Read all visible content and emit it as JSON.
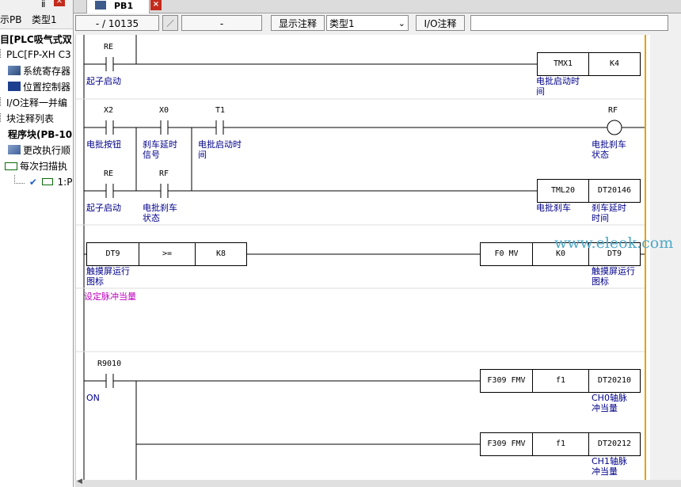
{
  "sidebar": {
    "tab1": "示PB",
    "tab2": "类型1",
    "pin_icon": "pin-icon",
    "items": [
      {
        "label": "目[PLC吸气式双",
        "bold": true
      },
      {
        "label": "PLC[FP-XH C3",
        "bold": false
      },
      {
        "label": "系统寄存器",
        "bold": false
      },
      {
        "label": "位置控制器",
        "bold": false
      },
      {
        "label": "I/O注释一并编",
        "bold": false
      },
      {
        "label": "块注释列表",
        "bold": false
      },
      {
        "label": "程序块(PB-10",
        "bold": true
      },
      {
        "label": "更改执行顺",
        "bold": false
      },
      {
        "label": "每次扫描执",
        "bold": false
      },
      {
        "label": "1:P",
        "bold": false
      }
    ]
  },
  "tab": {
    "label": "PB1"
  },
  "toolbar": {
    "address": "- / 10135",
    "blank": "-",
    "show_comment": "显示注释",
    "type_select": "类型1",
    "io_comment": "I/O注释"
  },
  "ladder": {
    "annotation": "设定脉冲当量",
    "watermark": "www.eleok.com",
    "contacts": [
      {
        "dev": "RE",
        "cmt": "起子启动"
      },
      {
        "dev": "X2",
        "cmt": "电批按钮"
      },
      {
        "dev": "X0",
        "cmt": "刹车延时\n信号"
      },
      {
        "dev": "T1",
        "cmt": "电批启动时\n间"
      },
      {
        "dev": "RE",
        "cmt": "起子启动"
      },
      {
        "dev": "RF",
        "cmt": "电批刹车\n状态"
      },
      {
        "dev": "R9010",
        "cmt": "ON"
      }
    ],
    "coil": {
      "dev": "RF",
      "cmt": "电批刹车\n状态"
    },
    "boxes": [
      {
        "a": "TMX1",
        "b": "K4",
        "cmt": "电批启动时\n间"
      },
      {
        "a": "TML20",
        "b": "DT20146",
        "cmt": "电批刹车",
        "cmt2": "刹车延时\n时间"
      },
      {
        "a": "DT9",
        "b": ">=",
        "c": "K8",
        "cmt": "触摸屏运行\n图标"
      },
      {
        "a": "F0 MV",
        "b": "K0",
        "c": "DT9",
        "cmt": "触摸屏运行\n图标"
      },
      {
        "a": "F309 FMV",
        "b": "f1",
        "c": "DT20210",
        "cmt": "CH0轴脉\n冲当量"
      },
      {
        "a": "F309 FMV",
        "b": "f1",
        "c": "DT20212",
        "cmt": "CH1轴脉\n冲当量"
      }
    ]
  }
}
